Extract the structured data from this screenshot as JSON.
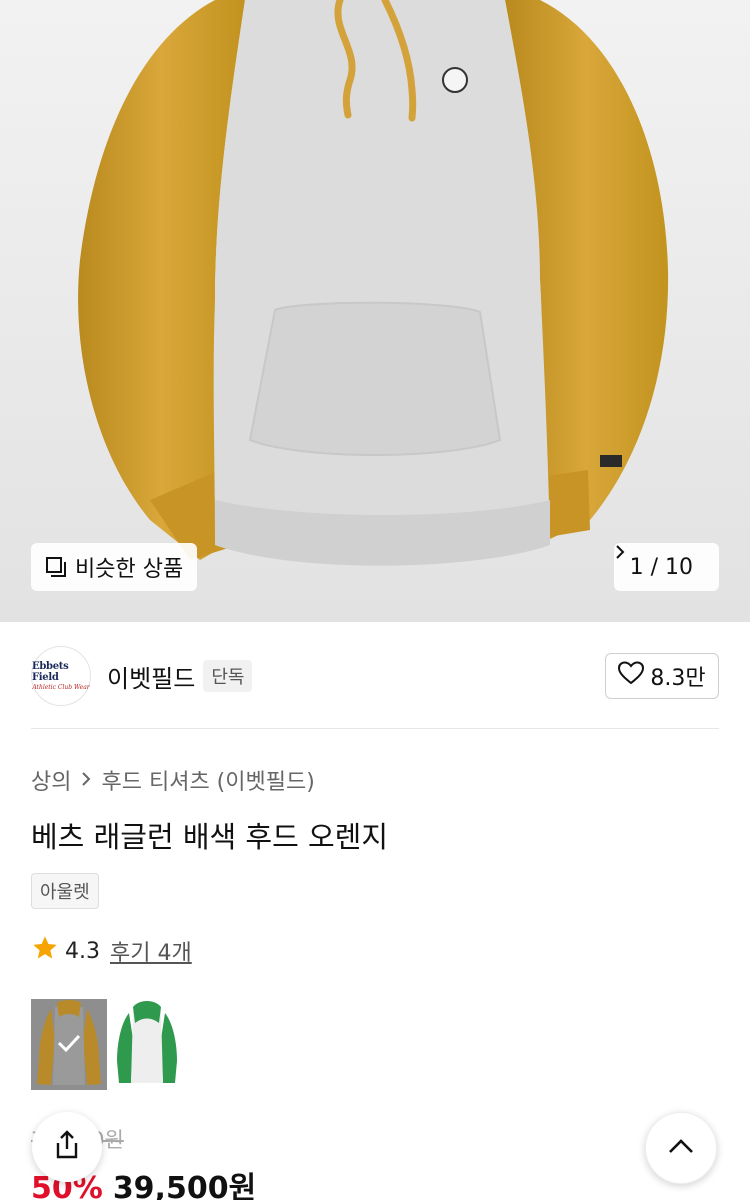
{
  "hero": {
    "similar_label": "비슷한 상품",
    "counter": "1 / 10",
    "image_icon": "product-photo"
  },
  "brand": {
    "logo_text": "Ebbets Field",
    "logo_sub": "Athletic Club Wear",
    "name": "이벳필드",
    "badge": "단독",
    "likes": "8.3만"
  },
  "breadcrumb": {
    "category": "상의",
    "subcategory": "후드 티셔츠 (이벳필드)"
  },
  "product": {
    "title": "베츠 래글런 배색 후드 오렌지",
    "tag": "아울렛",
    "rating": "4.3",
    "reviews": "후기 4개",
    "original_price": "79,000원",
    "discount": "50%",
    "sale_price": "39,500원"
  },
  "colors": {
    "accent": "#e0102b",
    "star": "#f6a400"
  },
  "icons": [
    "similar-icon",
    "chevron-right-icon",
    "heart-icon",
    "star-icon",
    "check-icon",
    "share-icon",
    "chevron-up-icon"
  ]
}
